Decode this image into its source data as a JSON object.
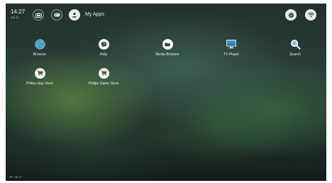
{
  "clock": {
    "time": "14:27",
    "date": "Jul. 5"
  },
  "nav": {
    "tabs": [
      {
        "icon": "tv-channels-icon"
      },
      {
        "icon": "gamepad-icon"
      },
      {
        "icon": "user-icon",
        "label": "My Apps"
      }
    ]
  },
  "status": [
    {
      "icon": "gear-icon"
    },
    {
      "icon": "wifi-icon"
    }
  ],
  "apps": [
    {
      "label": "Browser",
      "icon": "globe-icon"
    },
    {
      "label": "Help",
      "icon": "help-icon"
    },
    {
      "label": "Media Browser",
      "icon": "folder-icon"
    },
    {
      "label": "TV Player",
      "icon": "tv-icon"
    },
    {
      "label": "Search",
      "icon": "search-icon"
    },
    {
      "label": "Philips App Store",
      "icon": "cart-icon"
    },
    {
      "label": "Philips Game Store",
      "icon": "cart-icon"
    }
  ],
  "footer": {
    "help": "HELP"
  },
  "colors": {
    "accent": "#5da0e0",
    "icon_fill": "#f4f6f5"
  }
}
